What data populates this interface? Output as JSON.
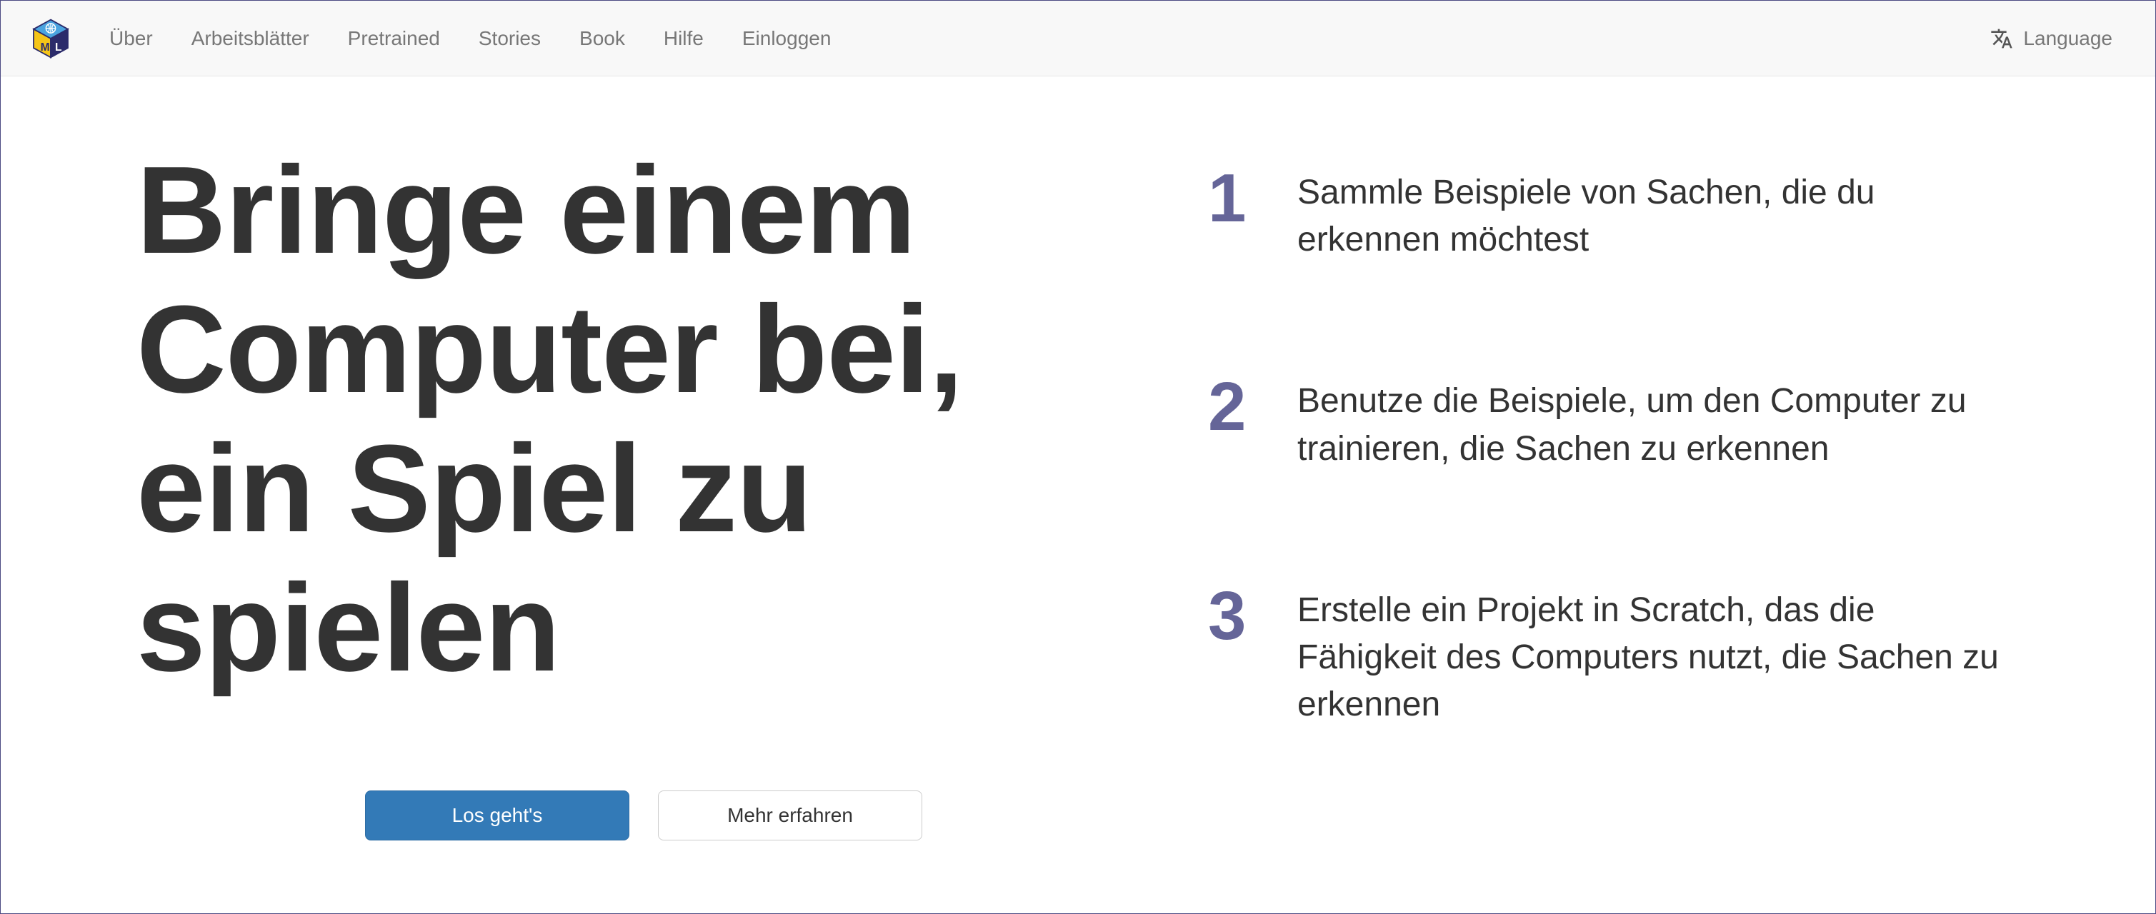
{
  "nav": {
    "items": [
      {
        "label": "Über"
      },
      {
        "label": "Arbeitsblätter"
      },
      {
        "label": "Pretrained"
      },
      {
        "label": "Stories"
      },
      {
        "label": "Book"
      },
      {
        "label": "Hilfe"
      },
      {
        "label": "Einloggen"
      }
    ],
    "language_label": "Language"
  },
  "hero": {
    "title": "Bringe einem Computer bei, ein Spiel zu spielen",
    "cta_primary": "Los geht's",
    "cta_secondary": "Mehr erfahren"
  },
  "steps": [
    {
      "num": "1",
      "text": "Sammle Beispiele von Sachen, die du erkennen möchtest"
    },
    {
      "num": "2",
      "text": "Benutze die Beispiele, um den Computer zu trainieren, die Sachen zu erkennen"
    },
    {
      "num": "3",
      "text": "Erstelle ein Projekt in Scratch, das die Fähigkeit des Computers nutzt, die Sachen zu erkennen"
    }
  ],
  "colors": {
    "step_number": "#656598",
    "primary_button": "#337ab7",
    "navbar_bg": "#f8f8f8",
    "text_dark": "#333333",
    "nav_link": "#777777"
  }
}
